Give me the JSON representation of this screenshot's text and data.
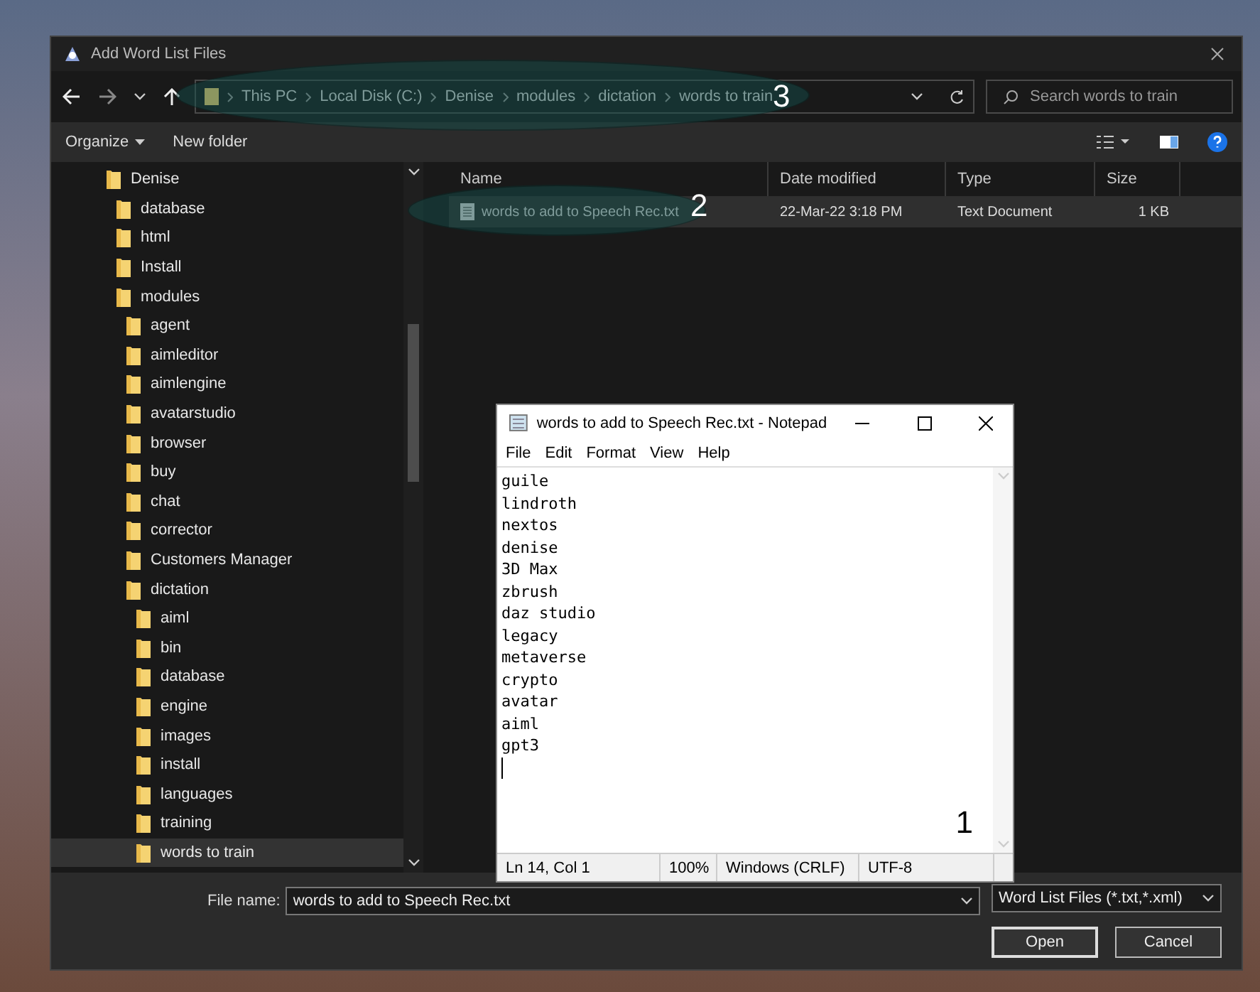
{
  "window": {
    "title": "Add Word List Files"
  },
  "address_bar": {
    "crumbs": [
      "This PC",
      "Local Disk (C:)",
      "Denise",
      "modules",
      "dictation",
      "words to train"
    ]
  },
  "search": {
    "placeholder": "Search words to train"
  },
  "toolbar": {
    "buttons": [
      "Organize",
      "New folder"
    ]
  },
  "tree": [
    {
      "label": "Denise",
      "selected": false,
      "children": [
        {
          "label": "database",
          "selected": false
        },
        {
          "label": "html",
          "selected": false
        },
        {
          "label": "Install",
          "selected": false
        },
        {
          "label": "modules",
          "selected": false,
          "children": [
            {
              "label": "agent",
              "selected": false
            },
            {
              "label": "aimleditor",
              "selected": false
            },
            {
              "label": "aimlengine",
              "selected": false
            },
            {
              "label": "avatarstudio",
              "selected": false
            },
            {
              "label": "browser",
              "selected": false
            },
            {
              "label": "buy",
              "selected": false
            },
            {
              "label": "chat",
              "selected": false
            },
            {
              "label": "corrector",
              "selected": false
            },
            {
              "label": "Customers Manager",
              "selected": false
            },
            {
              "label": "dictation",
              "selected": false,
              "children": [
                {
                  "label": "aiml",
                  "selected": false
                },
                {
                  "label": "bin",
                  "selected": false
                },
                {
                  "label": "database",
                  "selected": false
                },
                {
                  "label": "engine",
                  "selected": false
                },
                {
                  "label": "images",
                  "selected": false
                },
                {
                  "label": "install",
                  "selected": false
                },
                {
                  "label": "languages",
                  "selected": false
                },
                {
                  "label": "training",
                  "selected": false
                },
                {
                  "label": "words to train",
                  "selected": true
                }
              ]
            }
          ]
        }
      ]
    }
  ],
  "file_list": {
    "columns": [
      "Name",
      "Date modified",
      "Type",
      "Size"
    ],
    "rows": [
      {
        "name": "words to add to Speech Rec.txt",
        "date": "22-Mar-22 3:18 PM",
        "type": "Text Document",
        "size": "1 KB",
        "selected": true
      }
    ]
  },
  "notepad": {
    "title": "words to add to Speech Rec.txt - Notepad",
    "menu": [
      "File",
      "Edit",
      "Format",
      "View",
      "Help"
    ],
    "lines": [
      "guile",
      "lindroth",
      "nextos",
      "denise",
      "3D Max",
      "zbrush",
      "daz studio",
      "legacy",
      "metaverse",
      "crypto",
      "avatar",
      "aiml",
      "gpt3"
    ],
    "status": [
      "Ln 14, Col 1",
      "100%",
      "Windows (CRLF)",
      "UTF-8"
    ]
  },
  "footer": {
    "file_name_label": "File name:",
    "file_name": "words to add to Speech Rec.txt",
    "filter": "Word List Files (*.txt,*.xml)",
    "buttons": [
      "Open",
      "Cancel"
    ]
  },
  "annotations": [
    "3",
    "2",
    "1"
  ]
}
